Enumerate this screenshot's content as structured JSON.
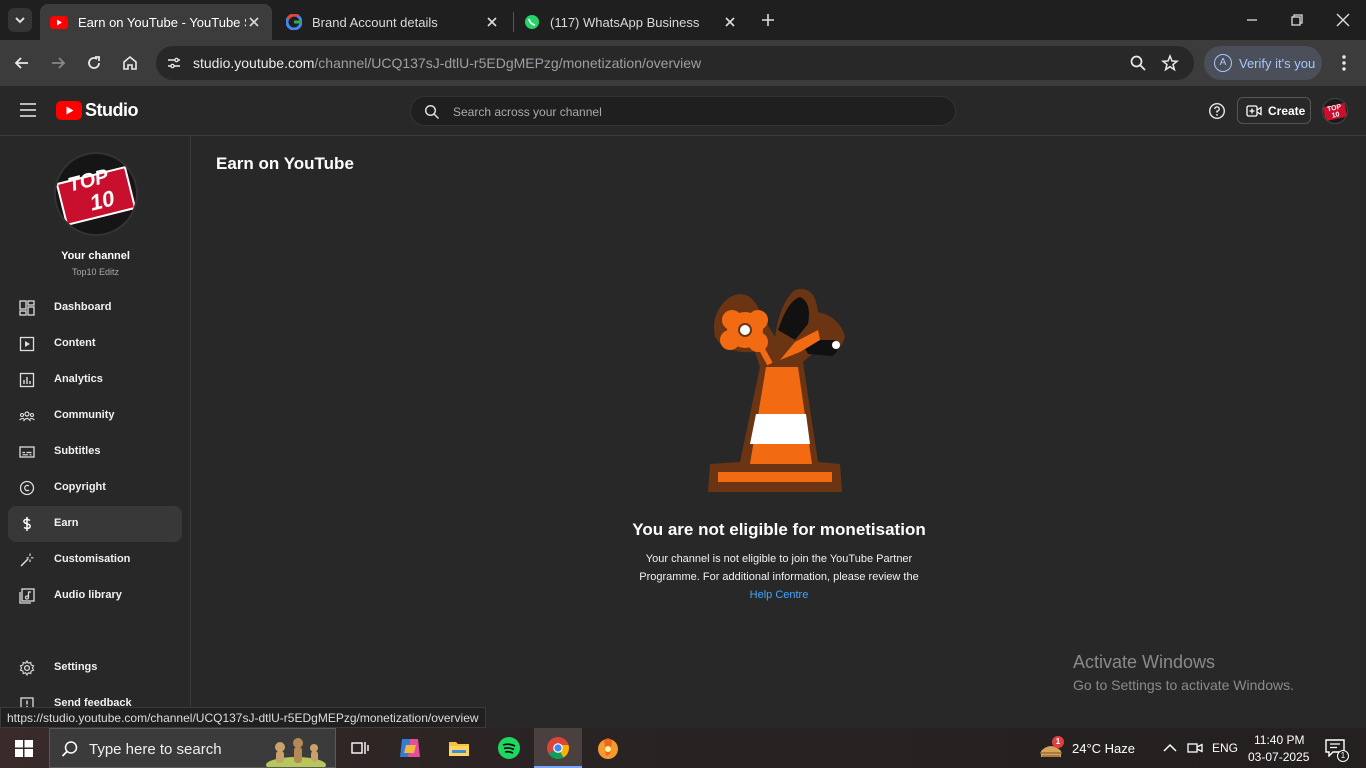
{
  "browser": {
    "tabs": [
      {
        "title": "Earn on YouTube - YouTube Studio",
        "active": true,
        "icon": "youtube-icon"
      },
      {
        "title": "Brand Account details",
        "active": false,
        "icon": "google-icon"
      },
      {
        "title": "(117) WhatsApp Business",
        "active": false,
        "icon": "whatsapp-icon"
      }
    ],
    "url_host": "studio.youtube.com",
    "url_path": "/channel/UCQ137sJ-dtlU-r5EDgMEPzg/monetization/overview",
    "profile_initial": "A",
    "verify_label": "Verify it's you"
  },
  "studio": {
    "logo_text": "Studio",
    "search_placeholder": "Search across your channel",
    "create_label": "Create",
    "avatar_text": "TOP 10"
  },
  "sidebar": {
    "channel_logo_line1": "TOP",
    "channel_logo_line2": "10",
    "channel_title": "Your channel",
    "channel_name": "Top10 Editz",
    "items": [
      {
        "label": "Dashboard",
        "icon": "dashboard-icon",
        "active": false
      },
      {
        "label": "Content",
        "icon": "content-icon",
        "active": false
      },
      {
        "label": "Analytics",
        "icon": "analytics-icon",
        "active": false
      },
      {
        "label": "Community",
        "icon": "community-icon",
        "active": false
      },
      {
        "label": "Subtitles",
        "icon": "subtitles-icon",
        "active": false
      },
      {
        "label": "Copyright",
        "icon": "copyright-icon",
        "active": false
      },
      {
        "label": "Earn",
        "icon": "earn-icon",
        "active": true
      },
      {
        "label": "Customisation",
        "icon": "customisation-icon",
        "active": false
      },
      {
        "label": "Audio library",
        "icon": "audio-library-icon",
        "active": false
      }
    ],
    "settings_label": "Settings",
    "feedback_label": "Send feedback"
  },
  "main": {
    "title": "Earn on YouTube",
    "empty_heading": "You are not eligible for monetisation",
    "empty_desc": "Your channel is not eligible to join the YouTube Partner Programme. For additional information, please review the",
    "help_link": "Help Centre"
  },
  "watermark": {
    "title": "Activate Windows",
    "subtitle": "Go to Settings to activate Windows."
  },
  "status_url": "https://studio.youtube.com/channel/UCQ137sJ-dtlU-r5EDgMEPzg/monetization/overview",
  "taskbar": {
    "search_placeholder": "Type here to search",
    "weather_badge": "1",
    "weather": "24°C  Haze",
    "language": "ENG",
    "time": "11:40 PM",
    "date": "03-07-2025",
    "notification_count": "1"
  },
  "colors": {
    "accent_red": "#ff0000",
    "link_blue": "#3ea6ff",
    "cone_orange": "#f26b12",
    "cone_outline": "#7a3b14"
  }
}
